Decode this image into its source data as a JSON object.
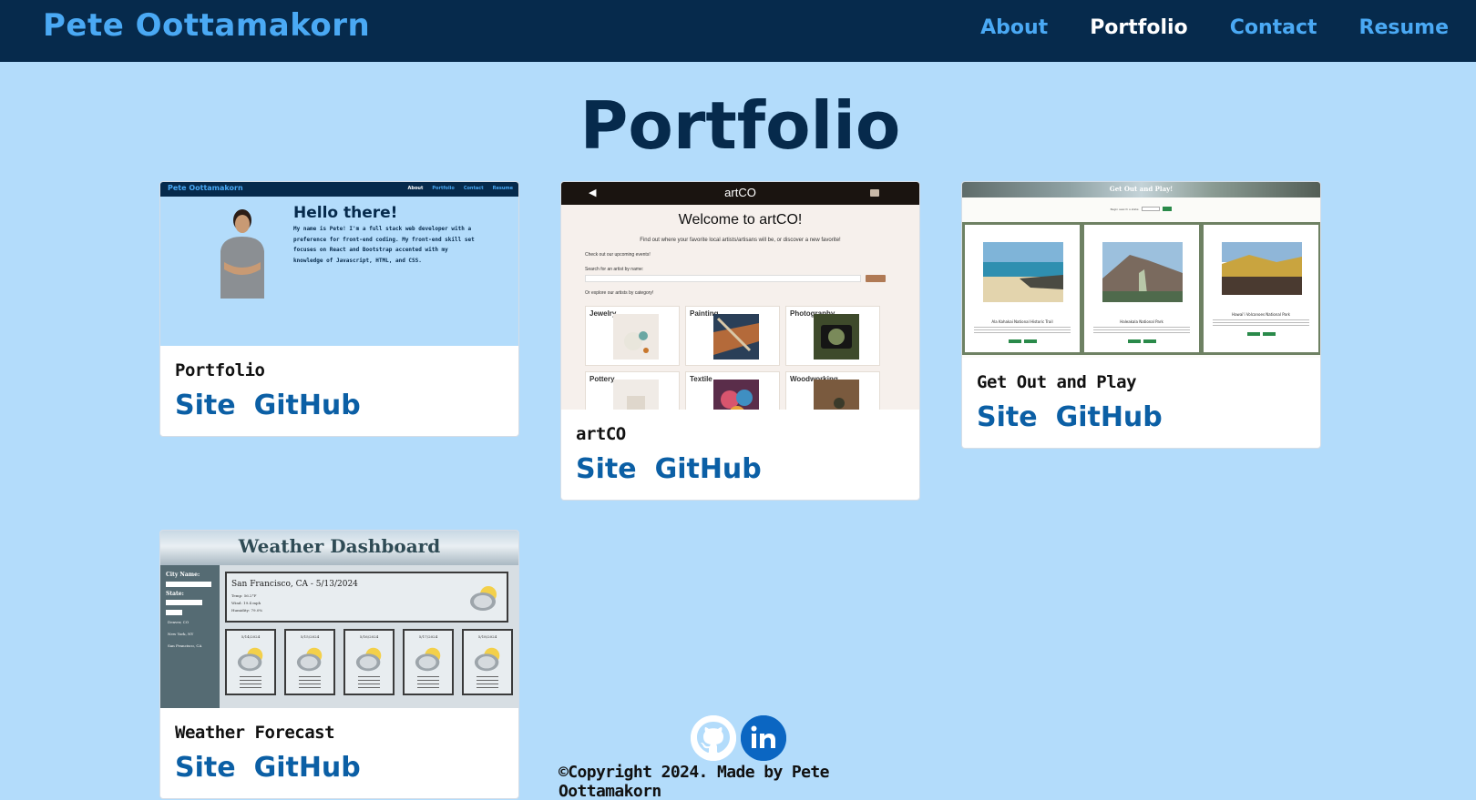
{
  "navbar": {
    "brand": "Pete Oottamakorn",
    "links": [
      "About",
      "Portfolio",
      "Contact",
      "Resume"
    ],
    "active": "Portfolio"
  },
  "page": {
    "title": "Portfolio"
  },
  "projects": [
    {
      "title": "Portfolio",
      "site_label": "Site",
      "github_label": "GitHub",
      "preview": {
        "brand": "Pete Oottamakorn",
        "nav": [
          "About",
          "Portfolio",
          "Contact",
          "Resume"
        ],
        "heading": "Hello there!",
        "intro": "My name is Pete! I'm a full stack web developer with a preference for front-end coding. My front-end skill set focuses on React and Bootstrap accented with my knowledge of Javascript, HTML, and CSS."
      }
    },
    {
      "title": "artCO",
      "site_label": "Site",
      "github_label": "GitHub",
      "preview": {
        "app_title": "artCO",
        "heading": "Welcome to artCO!",
        "subheading": "Find out where your favorite local artists/artisans will be, or discover a new favorite!",
        "events_line": "Check out our upcoming events!",
        "search_label": "Search for an artist by name:",
        "search_button": "Submit",
        "category_line": "Or explore our artists by category!",
        "categories": [
          "Jewelry",
          "Painting",
          "Photography",
          "Pottery",
          "Textile",
          "Woodworking"
        ]
      }
    },
    {
      "title": "Get Out and Play",
      "site_label": "Site",
      "github_label": "GitHub",
      "preview": {
        "heading": "Get Out and Play!",
        "form_label": "Begin search a state:",
        "parks": [
          "Ala Kahakai National Historic Trail",
          "Haleakala National Park",
          "Hawai'i Volcanoes National Park"
        ]
      }
    },
    {
      "title": "Weather Forecast",
      "site_label": "Site",
      "github_label": "GitHub",
      "preview": {
        "heading": "Weather Dashboard",
        "city_label": "City Name:",
        "city_placeholder": "city name",
        "state_label": "State:",
        "state_placeholder": "Select state...",
        "search_button": "search",
        "history": [
          "Denver, CO",
          "New York, NY",
          "San Francisco, CA"
        ],
        "current": "San Francisco, CA - 5/13/2024",
        "current_details": [
          "Temp: 56.2°F",
          "Wind: 19.4 mph",
          "Humidity: 79.0%"
        ],
        "forecast": [
          {
            "date": "5/14/2024",
            "temp": "Temp: 56.4°F",
            "wind": "Wind: 6 mph",
            "humidity": "Humidity: 80.0%"
          },
          {
            "date": "5/15/2024",
            "temp": "Temp: 56.3°F",
            "wind": "Wind: 6 mph",
            "humidity": "Humidity: 78.3%"
          },
          {
            "date": "5/16/2024",
            "temp": "Temp: 55.9°F",
            "wind": "Wind: 4 mph",
            "humidity": "Humidity: 81.2%"
          },
          {
            "date": "5/17/2024",
            "temp": "Temp: 57.1°F",
            "wind": "Wind: 11 mph",
            "humidity": "Humidity: 78.4%"
          },
          {
            "date": "5/18/2024",
            "temp": "Temp: 56.7°F",
            "wind": "Wind: 13 mph",
            "humidity": "Humidity: 80.1%"
          }
        ]
      }
    }
  ],
  "footer": {
    "social": [
      "github-icon",
      "linkedin-icon"
    ],
    "copyright": "©Copyright 2024. Made by Pete Oottamakorn"
  },
  "colors": {
    "navbar_bg": "#062a4c",
    "page_bg": "#b3dcfb",
    "link": "#0b5fa5",
    "brand": "#4aa9f4"
  }
}
